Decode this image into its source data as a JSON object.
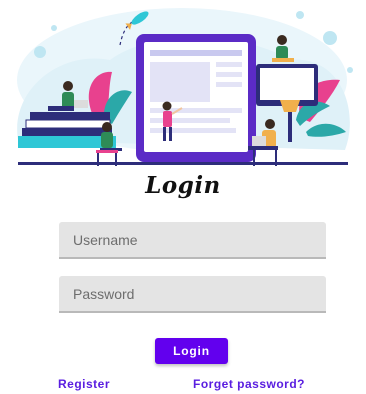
{
  "login": {
    "title": "Login",
    "username_placeholder": "Username",
    "password_placeholder": "Password",
    "login_button": "Login",
    "register_link": "Register",
    "forgot_link": "Forget password?"
  },
  "colors": {
    "accent": "#6200ee",
    "link": "#5a1ee0",
    "field_bg": "#e4e4e4"
  }
}
